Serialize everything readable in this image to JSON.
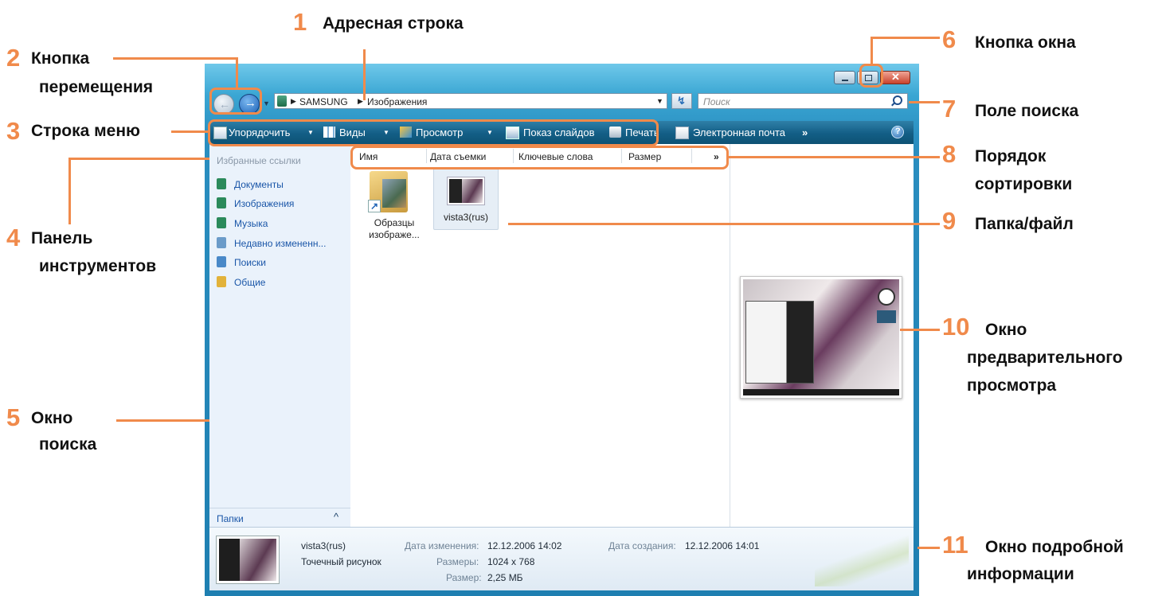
{
  "callouts": {
    "c1": {
      "num": "1",
      "label": "Адресная строка"
    },
    "c2": {
      "num": "2",
      "label_line1": "Кнопка",
      "label_line2": "перемещения"
    },
    "c3": {
      "num": "3",
      "label": "Строка меню"
    },
    "c4": {
      "num": "4",
      "label_line1": "Панель",
      "label_line2": "инструментов"
    },
    "c5": {
      "num": "5",
      "label_line1": "Окно",
      "label_line2": "поиска"
    },
    "c6": {
      "num": "6",
      "label": "Кнопка окна"
    },
    "c7": {
      "num": "7",
      "label": "Поле поиска"
    },
    "c8": {
      "num": "8",
      "label_line1": "Порядок",
      "label_line2": "сортировки"
    },
    "c9": {
      "num": "9",
      "label": "Папка/файл"
    },
    "c10": {
      "num": "10",
      "label_line1": "Окно",
      "label_line2": "предварительного",
      "label_line3": "просмотра"
    },
    "c11": {
      "num": "11",
      "label_line1": "Окно подробной",
      "label_line2": "информации"
    }
  },
  "address": {
    "crumb1": "SAMSUNG",
    "crumb2": "Изображения",
    "search_placeholder": "Поиск"
  },
  "toolbar": {
    "organize": "Упорядочить",
    "views": "Виды",
    "preview": "Просмотр",
    "slideshow": "Показ слайдов",
    "print": "Печать",
    "email": "Электронная почта",
    "more": "»",
    "help": "?"
  },
  "nav": {
    "header": "Избранные ссылки",
    "items": [
      {
        "label": "Документы",
        "color": "#2b8a5b"
      },
      {
        "label": "Изображения",
        "color": "#2b8a5b"
      },
      {
        "label": "Музыка",
        "color": "#2b8a5b"
      },
      {
        "label": "Недавно измененн...",
        "color": "#6b9bc9"
      },
      {
        "label": "Поиски",
        "color": "#4a89c8"
      },
      {
        "label": "Общие",
        "color": "#e2b23a"
      }
    ],
    "folders_label": "Папки"
  },
  "columns": [
    "Имя",
    "Дата съемки",
    "Ключевые слова",
    "Размер",
    "»"
  ],
  "files": [
    {
      "name_line1": "Образцы",
      "name_line2": "изображе..."
    },
    {
      "name_line1": "vista3(rus)"
    }
  ],
  "details": {
    "filename": "vista3(rus)",
    "filetype": "Точечный рисунок",
    "modified_label": "Дата изменения:",
    "modified_value": "12.12.2006 14:02",
    "dims_label": "Размеры:",
    "dims_value": "1024 x 768",
    "size_label": "Размер:",
    "size_value": "2,25 МБ",
    "created_label": "Дата создания:",
    "created_value": "12.12.2006 14:01"
  },
  "colors": {
    "accent": "#f08a4b",
    "toolbar": "#135e86",
    "link": "#1a56a8"
  }
}
